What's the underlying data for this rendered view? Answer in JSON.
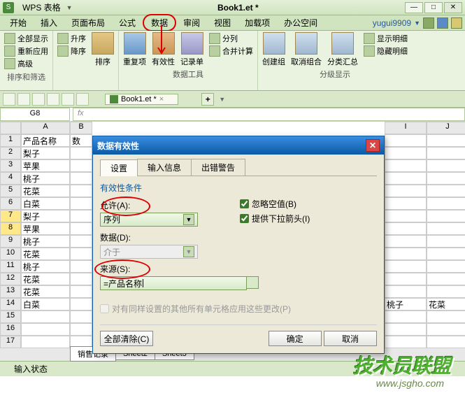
{
  "titlebar": {
    "app": "WPS 表格",
    "doc": "Book1.et *"
  },
  "menus": [
    "开始",
    "插入",
    "页面布局",
    "公式",
    "数据",
    "审阅",
    "视图",
    "加载项",
    "办公空间"
  ],
  "user": "yugui9909",
  "ribbon": {
    "group1": {
      "items": [
        "全部显示",
        "重新应用",
        "高级"
      ],
      "label": "排序和筛选"
    },
    "group2": {
      "sort_asc": "升序",
      "sort_desc": "降序",
      "sort": "排序"
    },
    "group3": {
      "dup": "重复项",
      "valid": "有效性",
      "form": "记录单",
      "split": "分列",
      "merge": "合并计算",
      "label": "数据工具"
    },
    "group4": {
      "create": "创建组",
      "ungroup": "取消组合",
      "sub": "分类汇总",
      "show": "显示明细",
      "hide": "隐藏明细",
      "label": "分级显示"
    }
  },
  "qat": {
    "doc_tab": "Book1.et *"
  },
  "namebox": "G8",
  "col_headers": [
    "A",
    "B",
    "I",
    "J"
  ],
  "rows": [
    {
      "n": "1",
      "a": "产品名称",
      "b": "数"
    },
    {
      "n": "2",
      "a": "梨子",
      "b": ""
    },
    {
      "n": "3",
      "a": "苹果",
      "b": ""
    },
    {
      "n": "4",
      "a": "桃子",
      "b": ""
    },
    {
      "n": "5",
      "a": "花菜",
      "b": ""
    },
    {
      "n": "6",
      "a": "白菜",
      "b": ""
    },
    {
      "n": "7",
      "a": "梨子",
      "b": "",
      "hl": true
    },
    {
      "n": "8",
      "a": "苹果",
      "b": "",
      "hl": true
    },
    {
      "n": "9",
      "a": "桃子",
      "b": ""
    },
    {
      "n": "10",
      "a": "花菜",
      "b": ""
    },
    {
      "n": "11",
      "a": "桃子",
      "b": ""
    },
    {
      "n": "12",
      "a": "花菜",
      "b": ""
    },
    {
      "n": "13",
      "a": "花菜",
      "b": ""
    },
    {
      "n": "14",
      "a": "白菜",
      "b": ""
    },
    {
      "n": "15",
      "a": "",
      "b": ""
    },
    {
      "n": "16",
      "a": "",
      "b": ""
    },
    {
      "n": "17",
      "a": "",
      "b": ""
    }
  ],
  "extra_i": "桃子",
  "extra_j": "花菜",
  "dialog": {
    "title": "数据有效性",
    "tabs": [
      "设置",
      "输入信息",
      "出错警告"
    ],
    "fs_label": "有效性条件",
    "allow_label": "允许(A):",
    "allow_value": "序列",
    "data_label": "数据(D):",
    "data_value": "介于",
    "source_label": "来源(S):",
    "source_value": "=产品名称",
    "ignore_blank": "忽略空值(B)",
    "dropdown": "提供下拉箭头(I)",
    "apply_all": "对有同样设置的其他所有单元格应用这些更改(P)",
    "clear": "全部清除(C)",
    "ok": "确定",
    "cancel": "取消"
  },
  "sheet_tabs": [
    "销售记录",
    "Sheet2",
    "Sheet3"
  ],
  "status": "输入状态",
  "watermark": "技术员联盟",
  "watermark_url": "www.jsgho.com"
}
